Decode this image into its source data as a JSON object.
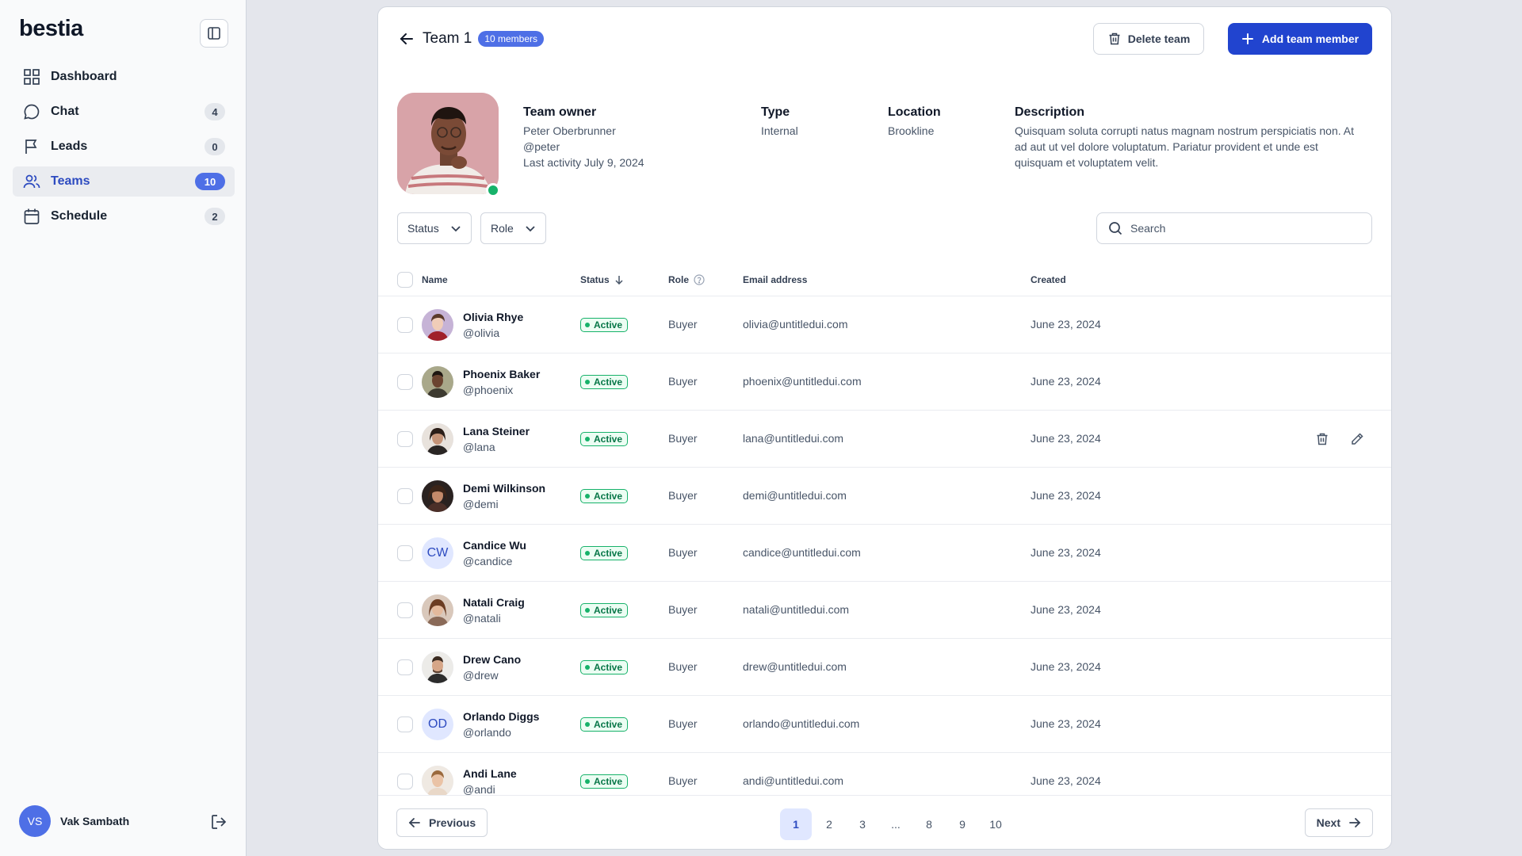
{
  "app": {
    "logo": "bestia"
  },
  "sidebar": {
    "items": [
      {
        "label": "Dashboard",
        "icon": "grid-icon",
        "count": ""
      },
      {
        "label": "Chat",
        "icon": "chat-icon",
        "count": "4"
      },
      {
        "label": "Leads",
        "icon": "flag-icon",
        "count": "0"
      },
      {
        "label": "Teams",
        "icon": "users-icon",
        "count": "10",
        "active": true
      },
      {
        "label": "Schedule",
        "icon": "calendar-icon",
        "count": "2"
      }
    ],
    "user": {
      "initials": "VS",
      "name": "Vak Sambath"
    }
  },
  "header": {
    "title": "Team 1",
    "members_badge": "10 members",
    "delete_label": "Delete team",
    "add_label": "Add team member"
  },
  "team_info": {
    "owner_heading": "Team owner",
    "owner_name": "Peter Oberbrunner",
    "owner_handle": "@peter",
    "owner_activity": "Last activity July 9, 2024",
    "type_heading": "Type",
    "type_value": "Internal",
    "location_heading": "Location",
    "location_value": "Brookline",
    "description_heading": "Description",
    "description_value": "Quisquam soluta corrupti natus magnam nostrum perspiciatis non. At ad aut ut vel dolore voluptatum. Pariatur provident et unde est quisquam et voluptatem velit."
  },
  "filters": {
    "status_label": "Status",
    "role_label": "Role",
    "search_placeholder": "Search"
  },
  "table": {
    "columns": {
      "name": "Name",
      "status": "Status",
      "role": "Role",
      "email": "Email address",
      "created": "Created"
    },
    "rows": [
      {
        "name": "Olivia Rhye",
        "handle": "@olivia",
        "status": "Active",
        "role": "Buyer",
        "email": "olivia@untitledui.com",
        "created": "June 23, 2024",
        "initials": ""
      },
      {
        "name": "Phoenix Baker",
        "handle": "@phoenix",
        "status": "Active",
        "role": "Buyer",
        "email": "phoenix@untitledui.com",
        "created": "June 23, 2024",
        "initials": ""
      },
      {
        "name": "Lana Steiner",
        "handle": "@lana",
        "status": "Active",
        "role": "Buyer",
        "email": "lana@untitledui.com",
        "created": "June 23, 2024",
        "initials": "",
        "hovered": true
      },
      {
        "name": "Demi Wilkinson",
        "handle": "@demi",
        "status": "Active",
        "role": "Buyer",
        "email": "demi@untitledui.com",
        "created": "June 23, 2024",
        "initials": ""
      },
      {
        "name": "Candice Wu",
        "handle": "@candice",
        "status": "Active",
        "role": "Buyer",
        "email": "candice@untitledui.com",
        "created": "June 23, 2024",
        "initials": "CW"
      },
      {
        "name": "Natali Craig",
        "handle": "@natali",
        "status": "Active",
        "role": "Buyer",
        "email": "natali@untitledui.com",
        "created": "June 23, 2024",
        "initials": ""
      },
      {
        "name": "Drew Cano",
        "handle": "@drew",
        "status": "Active",
        "role": "Buyer",
        "email": "drew@untitledui.com",
        "created": "June 23, 2024",
        "initials": ""
      },
      {
        "name": "Orlando Diggs",
        "handle": "@orlando",
        "status": "Active",
        "role": "Buyer",
        "email": "orlando@untitledui.com",
        "created": "June 23, 2024",
        "initials": "OD"
      },
      {
        "name": "Andi Lane",
        "handle": "@andi",
        "status": "Active",
        "role": "Buyer",
        "email": "andi@untitledui.com",
        "created": "June 23, 2024",
        "initials": ""
      }
    ]
  },
  "pagination": {
    "previous_label": "Previous",
    "next_label": "Next",
    "pages": [
      "1",
      "2",
      "3",
      "...",
      "8",
      "9",
      "10"
    ],
    "current": "1"
  },
  "colors": {
    "accent": "#2144cf",
    "badge": "#4e6fe6",
    "success": "#17b26a"
  }
}
